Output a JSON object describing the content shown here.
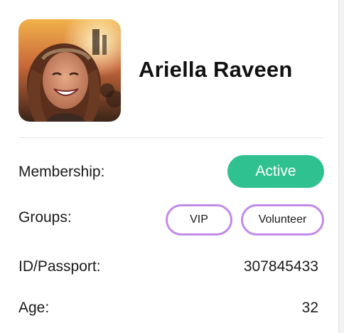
{
  "profile": {
    "name": "Ariella Raveen",
    "avatar_icon": "profile-photo"
  },
  "details": {
    "membership": {
      "label": "Membership:",
      "status": "Active",
      "status_color": "#2fc190"
    },
    "groups": {
      "label": "Groups:",
      "items": [
        "VIP",
        "Volunteer"
      ],
      "chip_border_color": "#c28ae8"
    },
    "id_passport": {
      "label": "ID/Passport:",
      "value": "307845433"
    },
    "age": {
      "label": "Age:",
      "value": "32"
    }
  }
}
